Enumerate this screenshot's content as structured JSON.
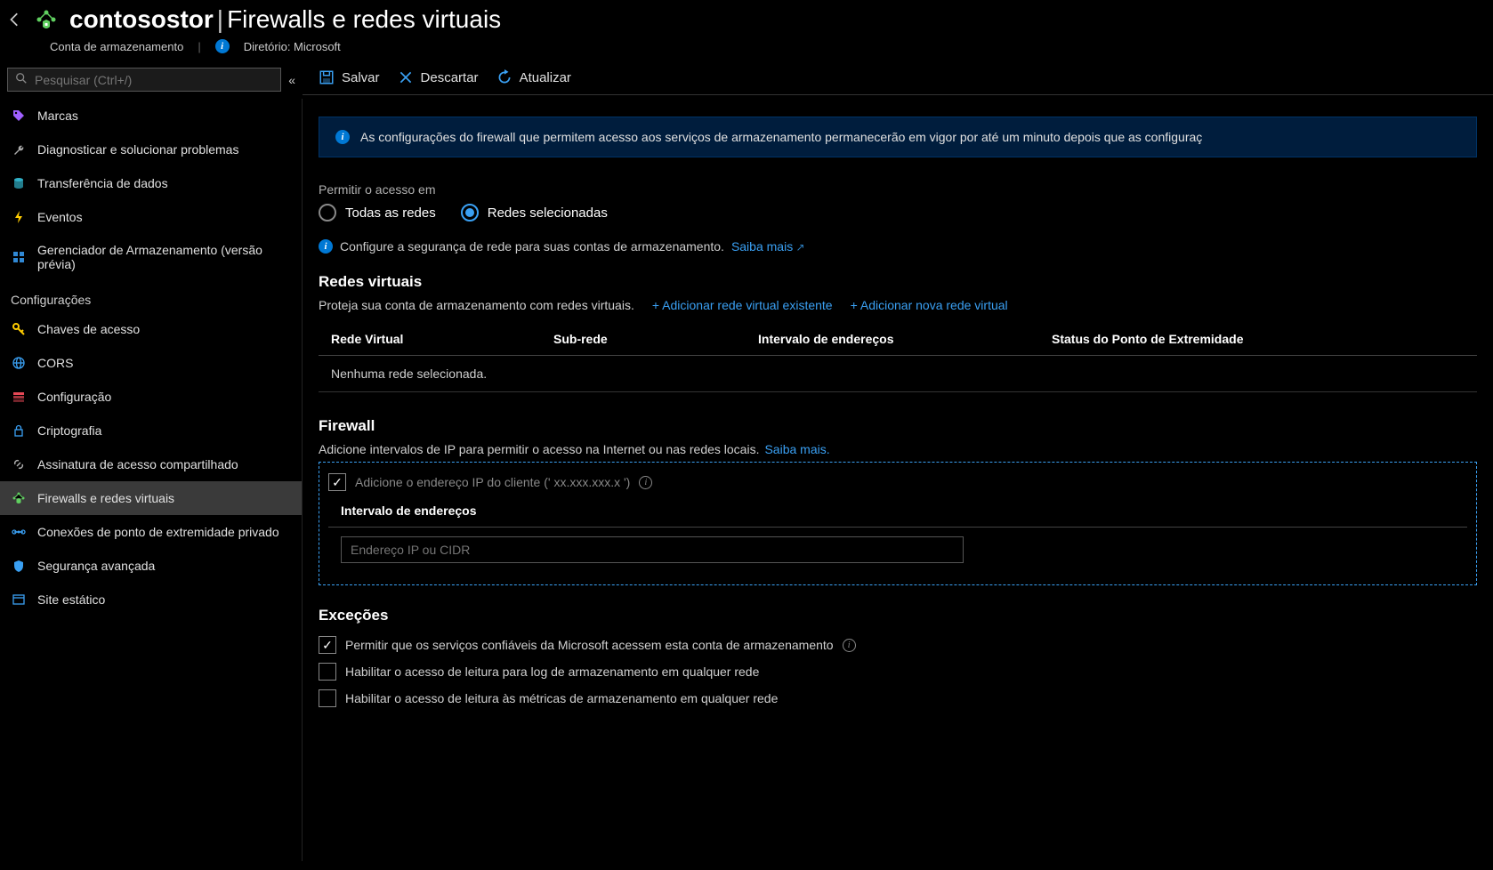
{
  "header": {
    "resource_name": "contosostor",
    "page_title": "Firewalls e redes virtuais",
    "resource_type": "Conta de armazenamento",
    "directory_label": "Diretório: Microsoft"
  },
  "sidebar": {
    "search_placeholder": "Pesquisar (Ctrl+/)",
    "items_top": [
      {
        "label": "Marcas",
        "icon": "tag-icon",
        "color": "#a060ff"
      },
      {
        "label": "Diagnosticar e solucionar problemas",
        "icon": "wrench-icon",
        "color": "#aaaaaa"
      },
      {
        "label": "Transferência de dados",
        "icon": "database-icon",
        "color": "#30b0c7"
      },
      {
        "label": "Eventos",
        "icon": "lightning-icon",
        "color": "#ffcc00"
      },
      {
        "label": "Gerenciador de Armazenamento (versão prévia)",
        "icon": "grid-icon",
        "color": "#3088d4"
      }
    ],
    "section_label": "Configurações",
    "items_settings": [
      {
        "label": "Chaves de acesso",
        "icon": "key-icon",
        "color": "#ffcc00"
      },
      {
        "label": "CORS",
        "icon": "globe-icon",
        "color": "#3aa0f3"
      },
      {
        "label": "Configuração",
        "icon": "stack-icon",
        "color": "#e74856"
      },
      {
        "label": "Criptografia",
        "icon": "lock-icon",
        "color": "#3aa0f3"
      },
      {
        "label": "Assinatura de acesso compartilhado",
        "icon": "link-icon",
        "color": "#aaaaaa"
      },
      {
        "label": "Firewalls e redes virtuais",
        "icon": "network-shield-icon",
        "color": "#60d060",
        "active": true
      },
      {
        "label": "Conexões de ponto de extremidade privado",
        "icon": "endpoint-icon",
        "color": "#3aa0f3"
      },
      {
        "label": "Segurança avançada",
        "icon": "shield-icon",
        "color": "#3aa0f3"
      },
      {
        "label": "Site estático",
        "icon": "website-icon",
        "color": "#3aa0f3"
      }
    ]
  },
  "toolbar": {
    "save": "Salvar",
    "discard": "Descartar",
    "refresh": "Atualizar"
  },
  "banner": {
    "text": "As configurações do firewall que permitem acesso aos serviços de armazenamento permanecerão em vigor por até um minuto depois que as configuraç"
  },
  "access": {
    "label": "Permitir o acesso em",
    "option_all": "Todas as redes",
    "option_selected": "Redes selecionadas",
    "help_text": "Configure a segurança de rede para suas contas de armazenamento.",
    "learn_more": "Saiba mais"
  },
  "vnet": {
    "title": "Redes virtuais",
    "desc": "Proteja sua conta de armazenamento com redes virtuais.",
    "add_existing": "+ Adicionar rede virtual existente",
    "add_new": "+ Adicionar nova rede virtual",
    "col_vnet": "Rede Virtual",
    "col_subnet": "Sub-rede",
    "col_range": "Intervalo de endereços",
    "col_status": "Status do Ponto de Extremidade",
    "empty": "Nenhuma rede selecionada."
  },
  "firewall": {
    "title": "Firewall",
    "desc": "Adicione intervalos de IP para permitir o acesso na Internet ou nas redes locais.",
    "learn_more": "Saiba mais.",
    "client_ip_label": "Adicione o endereço IP do cliente (' xx.xxx.xxx.x ')",
    "col_range": "Intervalo de endereços",
    "input_placeholder": "Endereço IP ou CIDR"
  },
  "exceptions": {
    "title": "Exceções",
    "opt_trusted": "Permitir que os serviços confiáveis da Microsoft acessem esta conta de armazenamento",
    "opt_logging": "Habilitar o acesso de leitura para log de armazenamento em qualquer rede",
    "opt_metrics": "Habilitar o acesso de leitura às métricas de armazenamento em qualquer rede"
  }
}
